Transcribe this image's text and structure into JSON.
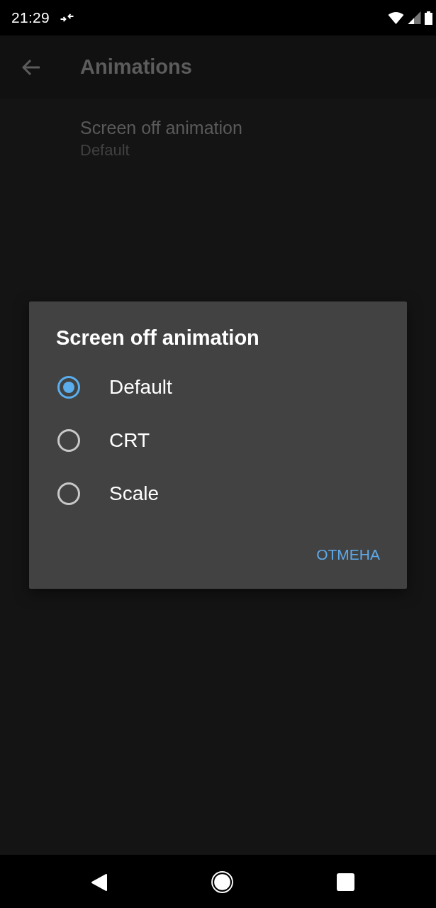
{
  "status_bar": {
    "time": "21:29"
  },
  "app_bar": {
    "title": "Animations"
  },
  "settings": [
    {
      "title": "Screen off animation",
      "summary": "Default"
    }
  ],
  "dialog": {
    "title": "Screen off animation",
    "options": [
      {
        "label": "Default",
        "selected": true
      },
      {
        "label": "CRT",
        "selected": false
      },
      {
        "label": "Scale",
        "selected": false
      }
    ],
    "buttons": [
      "ОТМЕНА"
    ]
  }
}
